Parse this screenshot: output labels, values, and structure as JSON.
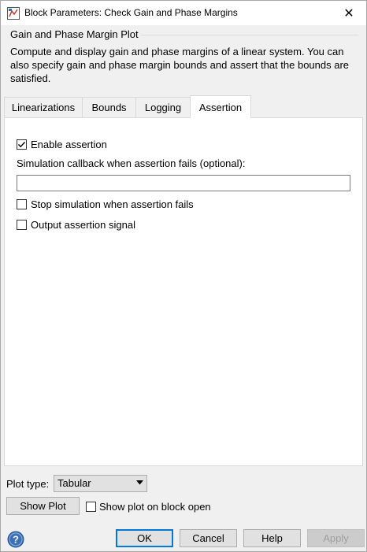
{
  "window": {
    "title": "Block Parameters: Check Gain and Phase Margins",
    "close_glyph": "✕"
  },
  "group": {
    "label": "Gain and Phase Margin Plot",
    "description": "Compute and display gain and phase margins of a linear system. You can also specify gain and phase margin bounds and assert that the bounds are satisfied."
  },
  "tabs": [
    {
      "label": "Linearizations",
      "active": false
    },
    {
      "label": "Bounds",
      "active": false
    },
    {
      "label": "Logging",
      "active": false
    },
    {
      "label": "Assertion",
      "active": true
    }
  ],
  "assertion": {
    "enable_label": "Enable assertion",
    "enable_checked": true,
    "callback_label": "Simulation callback when assertion fails (optional):",
    "callback_value": "",
    "stop_label": "Stop simulation when assertion fails",
    "stop_checked": false,
    "output_label": "Output assertion signal",
    "output_checked": false
  },
  "plot": {
    "type_label": "Plot type:",
    "type_value": "Tabular",
    "show_plot_label": "Show Plot",
    "show_on_open_label": "Show plot on block open",
    "show_on_open_checked": false
  },
  "buttons": {
    "ok": "OK",
    "cancel": "Cancel",
    "help": "Help",
    "apply": "Apply"
  },
  "icons": {
    "app": "simulink-block-icon",
    "help": "help-icon",
    "dropdown": "chevron-down-icon",
    "check": "checkmark-icon"
  },
  "colors": {
    "accent": "#0078d7",
    "help_icon": "#3b6fb6"
  }
}
